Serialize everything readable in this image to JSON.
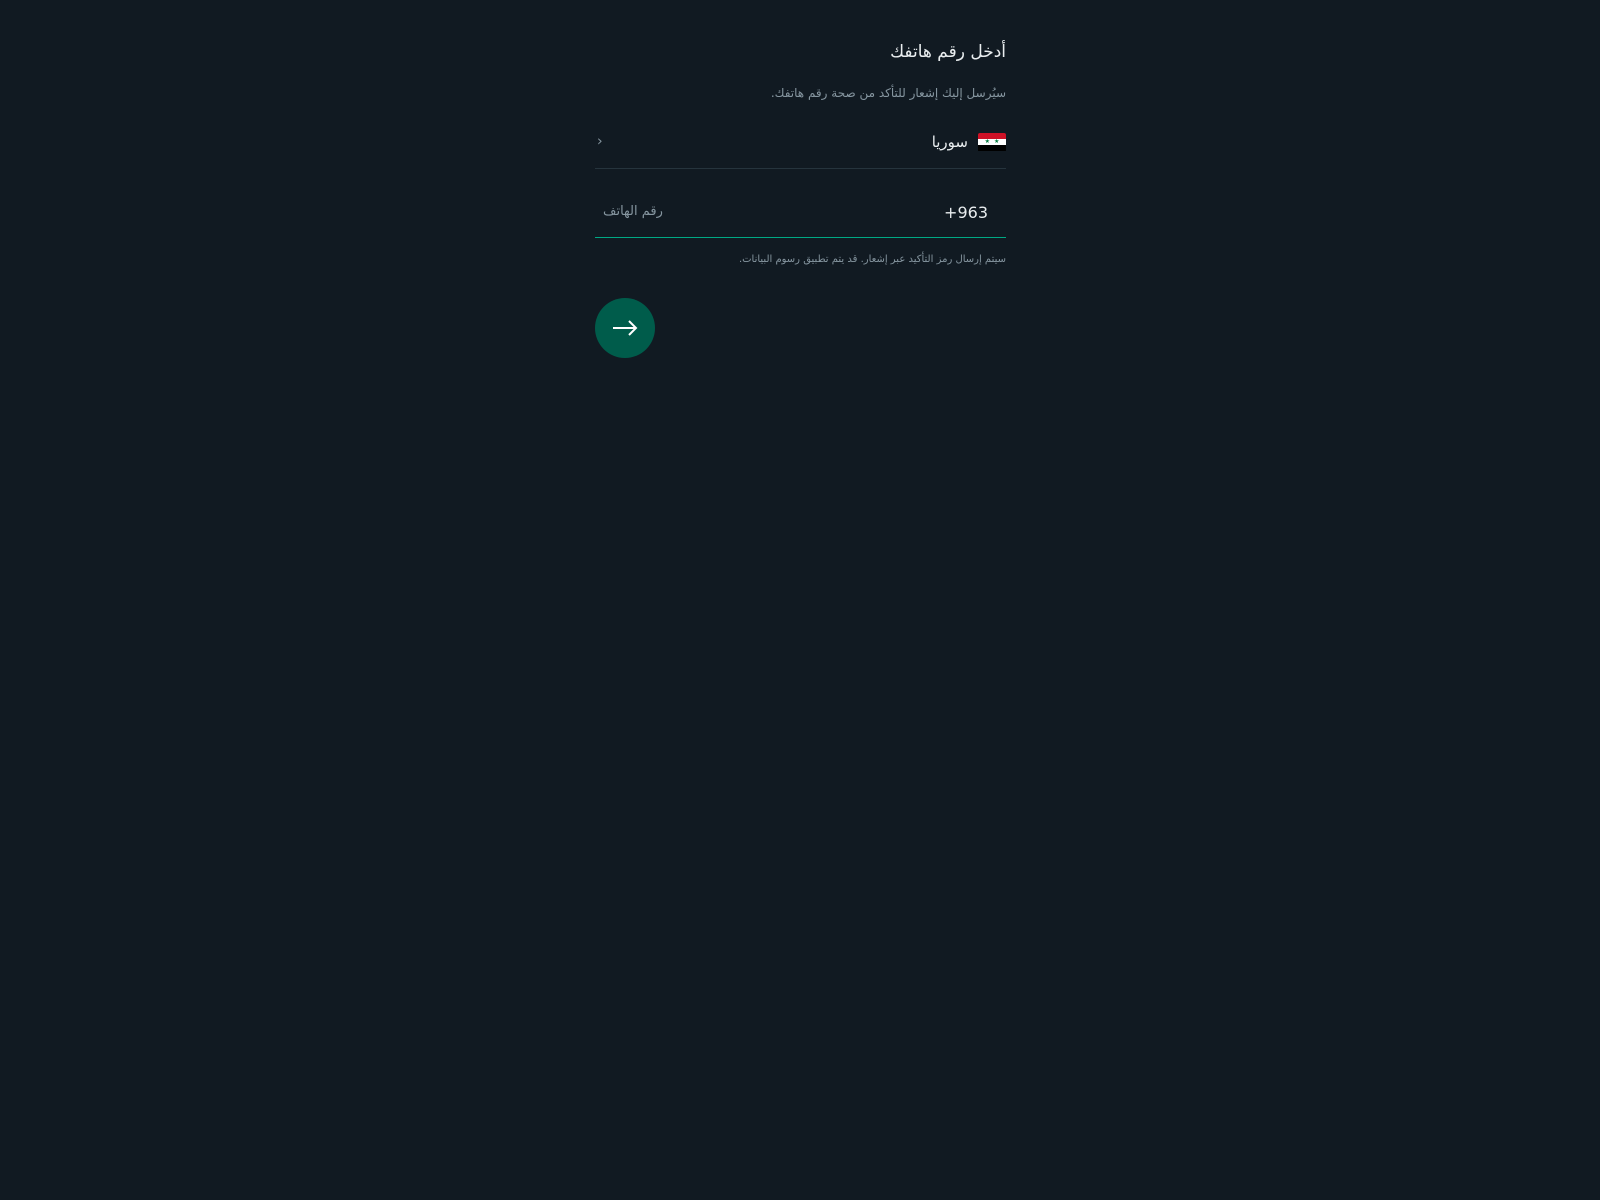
{
  "header": {
    "title": "أدخل رقم هاتفك",
    "subtitle": "سيُرسل إليك إشعار للتأكد من صحة رقم هاتفك."
  },
  "country_selector": {
    "flag": "syria-flag",
    "name": "سوريا",
    "chevron_icon": "chevron-left-icon"
  },
  "phone": {
    "dial_code": "+963",
    "placeholder": "رقم الهاتف",
    "value": ""
  },
  "note": "سيتم إرسال رمز التأكيد عبر إشعار. قد يتم تطبيق رسوم البيانات.",
  "next_button": {
    "icon": "arrow-right-icon"
  },
  "colors": {
    "background": "#111a22",
    "accent": "#00a884",
    "button": "#005c4b",
    "primary_text": "#e9edef",
    "secondary_text": "#8696a0"
  }
}
